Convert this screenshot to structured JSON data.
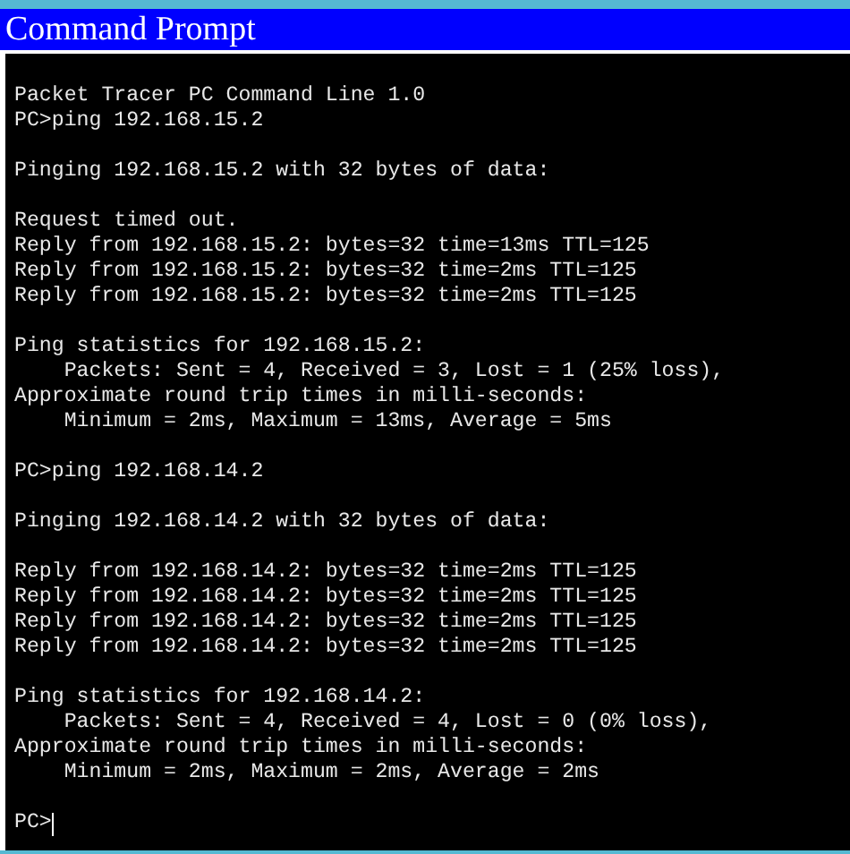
{
  "window": {
    "title": "Command Prompt"
  },
  "console": {
    "blocks": [
      [
        "Packet Tracer PC Command Line 1.0",
        "PC>ping 192.168.15.2"
      ],
      [
        "Pinging 192.168.15.2 with 32 bytes of data:"
      ],
      [
        "Request timed out.",
        "Reply from 192.168.15.2: bytes=32 time=13ms TTL=125",
        "Reply from 192.168.15.2: bytes=32 time=2ms TTL=125",
        "Reply from 192.168.15.2: bytes=32 time=2ms TTL=125"
      ],
      [
        "Ping statistics for 192.168.15.2:",
        "    Packets: Sent = 4, Received = 3, Lost = 1 (25% loss),",
        "Approximate round trip times in milli-seconds:",
        "    Minimum = 2ms, Maximum = 13ms, Average = 5ms"
      ],
      [
        "PC>ping 192.168.14.2"
      ],
      [
        "Pinging 192.168.14.2 with 32 bytes of data:"
      ],
      [
        "Reply from 192.168.14.2: bytes=32 time=2ms TTL=125",
        "Reply from 192.168.14.2: bytes=32 time=2ms TTL=125",
        "Reply from 192.168.14.2: bytes=32 time=2ms TTL=125",
        "Reply from 192.168.14.2: bytes=32 time=2ms TTL=125"
      ],
      [
        "Ping statistics for 192.168.14.2:",
        "    Packets: Sent = 4, Received = 4, Lost = 0 (0% loss),",
        "Approximate round trip times in milli-seconds:",
        "    Minimum = 2ms, Maximum = 2ms, Average = 2ms"
      ],
      [
        "PC>"
      ]
    ]
  }
}
